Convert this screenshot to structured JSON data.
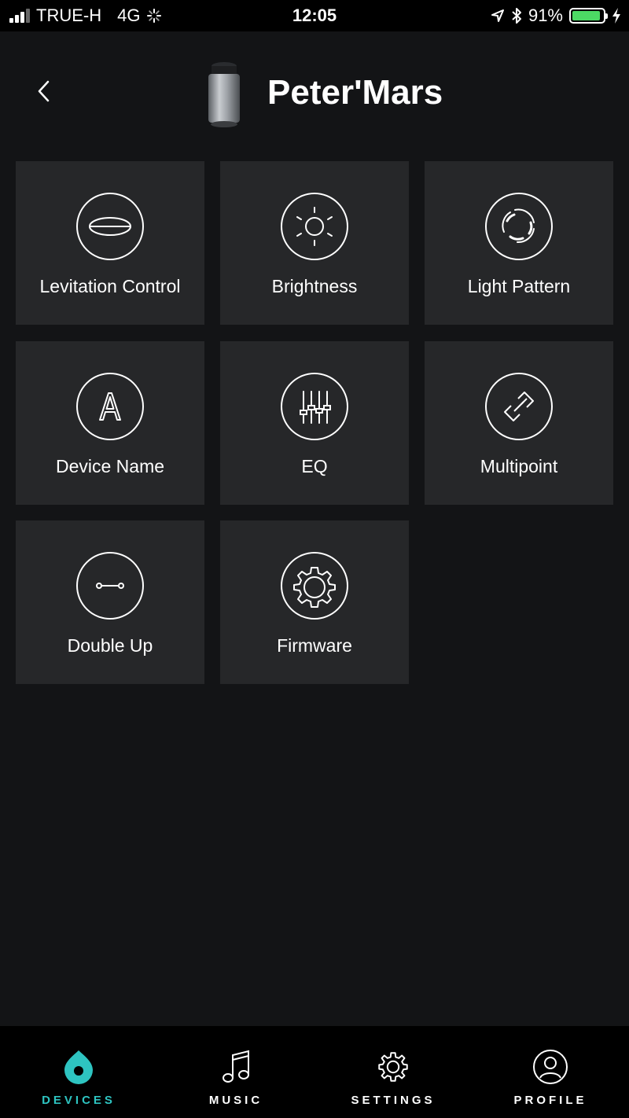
{
  "status_bar": {
    "carrier": "TRUE-H",
    "network": "4G",
    "time": "12:05",
    "battery_percent": "91%",
    "battery_level": 0.91
  },
  "header": {
    "title": "Peter'Mars"
  },
  "tiles": [
    {
      "label": "Levitation Control",
      "icon": "levitation-disc-icon"
    },
    {
      "label": "Brightness",
      "icon": "sun-icon"
    },
    {
      "label": "Light Pattern",
      "icon": "light-pattern-icon"
    },
    {
      "label": "Device Name",
      "icon": "letter-a-icon"
    },
    {
      "label": "EQ",
      "icon": "equalizer-sliders-icon"
    },
    {
      "label": "Multipoint",
      "icon": "link-icon"
    },
    {
      "label": "Double Up",
      "icon": "double-up-link-icon"
    },
    {
      "label": "Firmware",
      "icon": "gear-icon"
    }
  ],
  "nav": {
    "devices": "DEVICES",
    "music": "MUSIC",
    "settings": "SETTINGS",
    "profile": "PROFILE",
    "active": "devices"
  },
  "colors": {
    "accent": "#2ec4c1",
    "background": "#131416",
    "tile": "#262729",
    "battery": "#4cd964"
  }
}
